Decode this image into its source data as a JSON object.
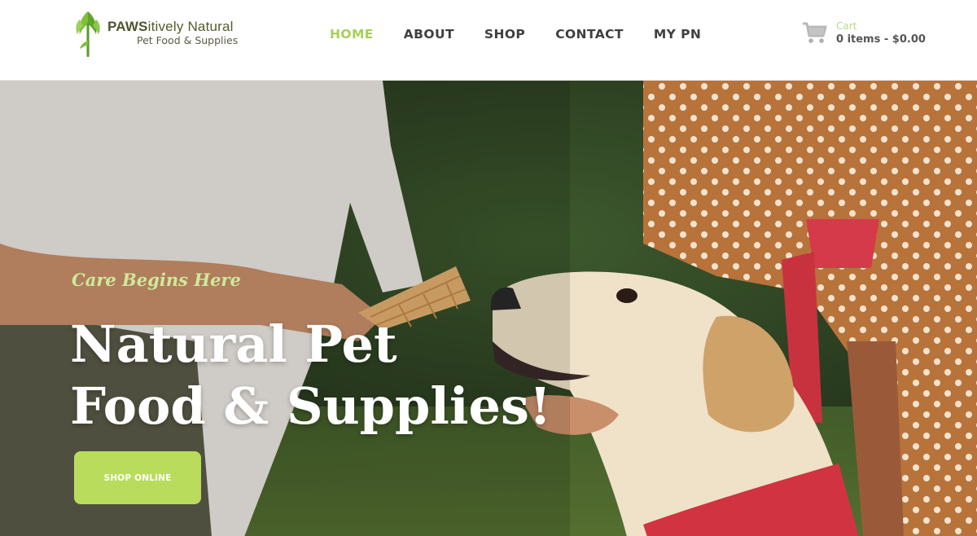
{
  "brand": {
    "name_bold": "PAWS",
    "name_rest": "itively Natural",
    "subtitle": "Pet Food & Supplies"
  },
  "nav": {
    "items": [
      {
        "label": "HOME",
        "active": true
      },
      {
        "label": "ABOUT",
        "active": false
      },
      {
        "label": "SHOP",
        "active": false
      },
      {
        "label": "CONTACT",
        "active": false
      },
      {
        "label": "MY PN",
        "active": false
      }
    ]
  },
  "cart": {
    "label": "Cart",
    "summary": "0 items - $0.00"
  },
  "hero": {
    "tagline": "Care Begins Here",
    "headline_line1": "Natural Pet",
    "headline_line2": "Food & Supplies!",
    "cta_label": "SHOP ONLINE"
  },
  "colors": {
    "accent": "#a8cf5a",
    "button": "#b9dc5c",
    "nav_text": "#3f3f3f"
  },
  "icons": {
    "logo": "leaf-paw-logo-icon",
    "cart": "shopping-cart-icon"
  }
}
